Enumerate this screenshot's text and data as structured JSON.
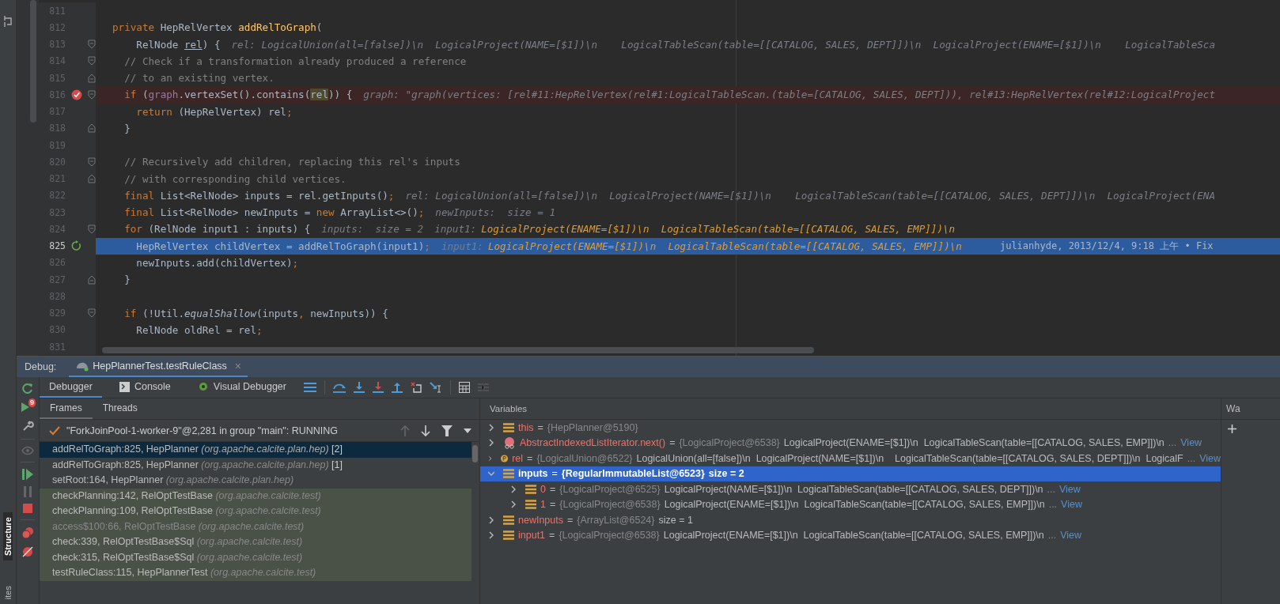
{
  "editor": {
    "lines": [
      {
        "num": "811"
      },
      {
        "num": "812",
        "tokens": [
          {
            "t": "private ",
            "kind": "kw"
          },
          {
            "t": "HepRelVertex ",
            "kind": "id"
          },
          {
            "t": "addRelToGraph",
            "kind": "decl"
          },
          {
            "t": "(",
            "kind": "id"
          }
        ]
      },
      {
        "num": "813",
        "fold_start": true,
        "tokens": [
          {
            "t": "    RelNode ",
            "kind": "id"
          },
          {
            "t": "rel",
            "kind": "ul"
          },
          {
            "t": ") {",
            "kind": "id"
          }
        ],
        "hints": [
          {
            "t": "rel: LogicalUnion(all=[false])\\n  LogicalProject(NAME=[$1])\\n    LogicalTableScan(table=[[CATALOG, SALES, DEPT]])\\n  LogicalProject(ENAME=[$1])\\n    LogicalTableSca",
            "kind": "hint"
          }
        ]
      },
      {
        "num": "814",
        "fold_start": true,
        "tokens": [
          {
            "t": "  // Check if a transformation already produced a reference",
            "kind": "cm"
          }
        ]
      },
      {
        "num": "815",
        "fold_end": true,
        "tokens": [
          {
            "t": "  // to an existing vertex.",
            "kind": "cm"
          }
        ]
      },
      {
        "num": "816",
        "fold_start": true,
        "breakpoint": true,
        "tokens": [
          {
            "t": "  if ",
            "kind": "kw"
          },
          {
            "t": "(",
            "kind": "id"
          },
          {
            "t": "graph",
            "kind": "field"
          },
          {
            "t": ".vertexSet().contains(",
            "kind": "id"
          },
          {
            "t": "rel",
            "kind": "hl"
          },
          {
            "t": ")) {",
            "kind": "id"
          }
        ],
        "hints": [
          {
            "t": "graph: \"graph(vertices: [rel#11:HepRelVertex(rel#1:LogicalTableScan.(table=[CATALOG, SALES, DEPT])), rel#13:HepRelVertex(rel#12:LogicalProject",
            "kind": "hint"
          }
        ]
      },
      {
        "num": "817",
        "tokens": [
          {
            "t": "    return ",
            "kind": "kw"
          },
          {
            "t": "(HepRelVertex) rel",
            "kind": "id"
          },
          {
            "t": ";",
            "kind": "kw"
          }
        ]
      },
      {
        "num": "818",
        "fold_end": true,
        "tokens": [
          {
            "t": "  }",
            "kind": "id"
          }
        ]
      },
      {
        "num": "819"
      },
      {
        "num": "820",
        "fold_start": true,
        "tokens": [
          {
            "t": "  // Recursively add children, replacing this rel's inputs",
            "kind": "cm"
          }
        ]
      },
      {
        "num": "821",
        "fold_end": true,
        "tokens": [
          {
            "t": "  // with corresponding child vertices.",
            "kind": "cm"
          }
        ]
      },
      {
        "num": "822",
        "tokens": [
          {
            "t": "  final ",
            "kind": "kw"
          },
          {
            "t": "List<RelNode> inputs = rel.getInputs()",
            "kind": "id"
          },
          {
            "t": ";",
            "kind": "kw"
          }
        ],
        "hints": [
          {
            "t": "rel: LogicalUnion(all=[false])\\n  LogicalProject(NAME=[$1])\\n    LogicalTableScan(table=[[CATALOG, SALES, DEPT]])\\n  LogicalProject(ENA",
            "kind": "hint"
          }
        ]
      },
      {
        "num": "823",
        "tokens": [
          {
            "t": "  final ",
            "kind": "kw"
          },
          {
            "t": "List<RelNode> newInputs = ",
            "kind": "id"
          },
          {
            "t": "new ",
            "kind": "kw"
          },
          {
            "t": "ArrayList<>()",
            "kind": "id"
          },
          {
            "t": ";",
            "kind": "kw"
          }
        ],
        "hints": [
          {
            "t": "newInputs:  size = 1",
            "kind": "hint"
          }
        ]
      },
      {
        "num": "824",
        "fold_start": true,
        "tokens": [
          {
            "t": "  for ",
            "kind": "kw"
          },
          {
            "t": "(RelNode input1 : inputs) {",
            "kind": "id"
          }
        ],
        "hints": [
          {
            "t": "inputs:  size = 2",
            "kind": "hint"
          },
          {
            "t": "input1:",
            "kind": "hint"
          },
          {
            "t": "LogicalProject(ENAME=[$1])\\n  LogicalTableScan(table=[[CATALOG, SALES, EMP]])\\n",
            "kind": "changed"
          }
        ]
      },
      {
        "num": "825",
        "current": true,
        "tokens": [
          {
            "t": "    HepRelVertex childVertex = addRelToGraph(input1)",
            "kind": "id"
          },
          {
            "t": ";",
            "kind": "kw"
          }
        ],
        "hints": [
          {
            "t": "input1:",
            "kind": "hint"
          },
          {
            "t": "LogicalProject(ENAME=[$1])\\n  LogicalTableScan(table=[[CATALOG, SALES, EMP]])\\n",
            "kind": "changed"
          },
          {
            "t": "julianhyde, 2013/12/4, 9:18 上午 • Fix",
            "kind": "blame"
          }
        ]
      },
      {
        "num": "826",
        "tokens": [
          {
            "t": "    newInputs.add(childVertex)",
            "kind": "id"
          },
          {
            "t": ";",
            "kind": "kw"
          }
        ]
      },
      {
        "num": "827",
        "fold_end": true,
        "tokens": [
          {
            "t": "  }",
            "kind": "id"
          }
        ]
      },
      {
        "num": "828"
      },
      {
        "num": "829",
        "fold_start": true,
        "tokens": [
          {
            "t": "  if ",
            "kind": "kw"
          },
          {
            "t": "(!Util.",
            "kind": "id"
          },
          {
            "t": "equalShallow",
            "kind": "it"
          },
          {
            "t": "(inputs",
            "kind": "id"
          },
          {
            "t": ", ",
            "kind": "kw"
          },
          {
            "t": "newInputs)) {",
            "kind": "id"
          }
        ]
      },
      {
        "num": "830",
        "tokens": [
          {
            "t": "    RelNode oldRel = rel",
            "kind": "id"
          },
          {
            "t": ";",
            "kind": "kw"
          }
        ]
      },
      {
        "num": "831"
      }
    ]
  },
  "side_tabs": [
    "Structure",
    "ites"
  ],
  "debug": {
    "label": "Debug:",
    "session_tab": "HepPlannerTest.testRuleClass",
    "close": "×",
    "rerun_badge": "9",
    "tabs": [
      {
        "label": "Debugger",
        "selected": true
      },
      {
        "label": "Console",
        "selected": false
      },
      {
        "label": "Visual Debugger",
        "selected": false
      }
    ],
    "frame_tabs": [
      {
        "label": "Frames",
        "selected": true
      },
      {
        "label": "Threads",
        "selected": false
      }
    ],
    "thread": "\"ForkJoinPool-1-worker-9\"@2,281 in group \"main\": RUNNING",
    "frames": [
      {
        "method": "addRelToGraph:825, HepPlanner",
        "package": "(org.apache.calcite.plan.hep)",
        "count": "[2]",
        "selected": true,
        "library": false,
        "dimmed": false
      },
      {
        "method": "addRelToGraph:825, HepPlanner",
        "package": "(org.apache.calcite.plan.hep)",
        "count": "[1]",
        "selected": false,
        "library": false,
        "dimmed": false
      },
      {
        "method": "setRoot:164, HepPlanner",
        "package": "(org.apache.calcite.plan.hep)",
        "selected": false,
        "library": false,
        "dimmed": false
      },
      {
        "method": "checkPlanning:142, RelOptTestBase",
        "package": "(org.apache.calcite.test)",
        "selected": false,
        "library": true,
        "dimmed": false
      },
      {
        "method": "checkPlanning:109, RelOptTestBase",
        "package": "(org.apache.calcite.test)",
        "selected": false,
        "library": true,
        "dimmed": false
      },
      {
        "method": "access$100:66, RelOptTestBase",
        "package": "(org.apache.calcite.test)",
        "selected": false,
        "library": true,
        "dimmed": true
      },
      {
        "method": "check:339, RelOptTestBase$Sql",
        "package": "(org.apache.calcite.test)",
        "selected": false,
        "library": true,
        "dimmed": false
      },
      {
        "method": "check:315, RelOptTestBase$Sql",
        "package": "(org.apache.calcite.test)",
        "selected": false,
        "library": true,
        "dimmed": false
      },
      {
        "method": "testRuleClass:115, HepPlannerTest",
        "package": "(org.apache.calcite.test)",
        "selected": false,
        "library": true,
        "dimmed": false
      }
    ],
    "variables_title": "Variables",
    "variables": [
      {
        "kind": "field",
        "name": "this",
        "op": "=",
        "type": "{HepPlanner@5190}",
        "expanded": false,
        "selected": false
      },
      {
        "kind": "method",
        "name": "AbstractIndexedListIterator.next()",
        "op": "=",
        "type": "{LogicalProject@6538}",
        "value": "LogicalProject(ENAME=[$1])\\n  LogicalTableScan(table=[[CATALOG, SALES, EMP]])\\n",
        "more": "...",
        "link": "View",
        "expanded": false,
        "selected": false
      },
      {
        "kind": "param",
        "name": "rel",
        "op": "=",
        "type": "{LogicalUnion@6522}",
        "value": "LogicalUnion(all=[false])\\n  LogicalProject(NAME=[$1])\\n    LogicalTableScan(table=[[CATALOG, SALES, DEPT]])\\n  LogicalF",
        "more": "...",
        "link": "View",
        "expanded": false,
        "selected": false
      },
      {
        "kind": "field",
        "name": "inputs",
        "op": "=",
        "type": "{RegularImmutableList@6523}",
        "value": "size = 2",
        "expanded": true,
        "selected": true,
        "children": [
          {
            "kind": "field",
            "name": "0",
            "op": "=",
            "type": "{LogicalProject@6525}",
            "value": "LogicalProject(NAME=[$1])\\n  LogicalTableScan(table=[[CATALOG, SALES, DEPT]])\\n",
            "more": "...",
            "link": "View",
            "expanded": false,
            "selected": false
          },
          {
            "kind": "field",
            "name": "1",
            "op": "=",
            "type": "{LogicalProject@6538}",
            "value": "LogicalProject(ENAME=[$1])\\n  LogicalTableScan(table=[[CATALOG, SALES, EMP]])\\n",
            "more": "...",
            "link": "View",
            "expanded": false,
            "selected": false
          }
        ]
      },
      {
        "kind": "field",
        "name": "newInputs",
        "op": "=",
        "type": "{ArrayList@6524}",
        "value": "size = 1",
        "expanded": false,
        "selected": false
      },
      {
        "kind": "field",
        "name": "input1",
        "op": "=",
        "type": "{LogicalProject@6538}",
        "value": "LogicalProject(ENAME=[$1])\\n  LogicalTableScan(table=[[CATALOG, SALES, EMP]])\\n",
        "more": "...",
        "link": "View",
        "expanded": false,
        "selected": false
      }
    ],
    "watches_tab": "Wa"
  }
}
